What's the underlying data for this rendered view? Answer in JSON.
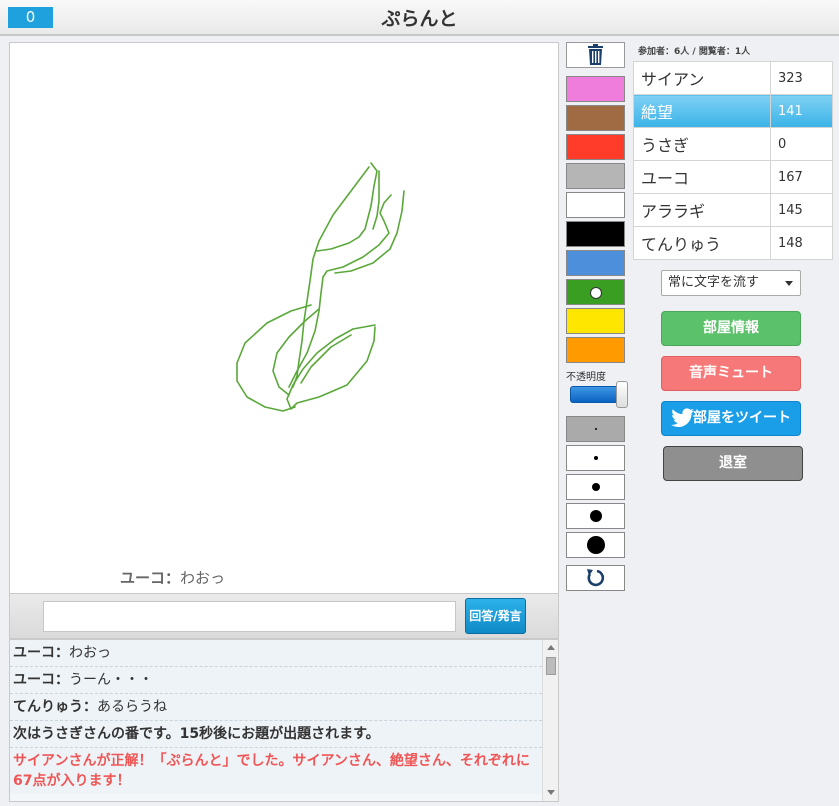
{
  "header": {
    "timer": "0",
    "title": "ぷらんと"
  },
  "canvas": {
    "bubble": {
      "name": "ユーコ",
      "sep": "：",
      "text": "わおっ"
    },
    "strokes": [
      "M370,162 L376,170 L373,185 L370,205 L364,228 L358,236 L348,242 L330,248 L316,250",
      "M368,166 L350,190 L332,214 L318,240 L312,258 L309,280 L306,300 L303,320 L301,340 L298,360 L296,375 L292,386",
      "M378,170 L378,200 L376,215 L372,228",
      "M390,194 L383,202 L379,212 L383,220 L388,232 L378,244 L362,256 L342,266 L326,270 L322,276 L320,292 L318,310 L314,330 L306,352 L296,370 L288,386",
      "M403,190 L401,210 L396,232 L389,248 L372,262 L350,270 L334,272",
      "M310,304 L290,310 L266,322 L244,342 L236,362 L236,380 L246,396 L264,406 L282,410 L294,406",
      "M318,308 L304,320 L288,336 L276,352 L272,370 L278,386 L288,394",
      "M374,324 L352,328 L334,338 L316,352 L302,368 L292,384 L286,398 L290,408 L296,402 L318,396 L346,384 L366,360 L373,340 L374,326",
      "M350,334 L330,346 L310,366 L300,382"
    ],
    "stroke_color": "#5aa83a"
  },
  "input": {
    "placeholder": "",
    "value": "",
    "button_label": "回答/発言"
  },
  "chat": [
    {
      "name": "ユーコ",
      "sep": "：",
      "text": "わおっ"
    },
    {
      "name": "ユーコ",
      "sep": "：",
      "text": "うーん・・・"
    },
    {
      "name": "てんりゅう",
      "sep": "：",
      "text": "あるらうね"
    }
  ],
  "chat_system": "次はうさぎさんの番です。15秒後にお題が出題されます。",
  "chat_correct": "サイアンさんが正解！「ぷらんと」でした。サイアンさん、絶望さん、それぞれに67点が入ります！",
  "tools": {
    "colors": [
      "#ee7ddc",
      "#a06a42",
      "#ff3b2a",
      "#b5b5b5",
      "#ffffff",
      "#000000",
      "#4e8fdc",
      "#3a9e22",
      "#ffe600",
      "#ff9a00"
    ],
    "selected_color_index": 7,
    "opacity_label": "不透明度",
    "opacity": 1.0,
    "brush_sizes": [
      2,
      4,
      8,
      12,
      18
    ],
    "selected_brush_index": 0
  },
  "panel": {
    "participants": "参加者：6人 / 閲覧者：1人",
    "players": [
      {
        "name": "サイアン",
        "score": "323"
      },
      {
        "name": "絶望",
        "score": "141",
        "active": true
      },
      {
        "name": "うさぎ",
        "score": "0"
      },
      {
        "name": "ユーコ",
        "score": "167"
      },
      {
        "name": "アララギ",
        "score": "145"
      },
      {
        "name": "てんりゅう",
        "score": "148"
      }
    ],
    "scroll_mode": "常に文字を流す",
    "btn_info": "部屋情報",
    "btn_mute": "音声ミュート",
    "btn_tweet": "部屋をツイート",
    "btn_leave": "退室"
  }
}
